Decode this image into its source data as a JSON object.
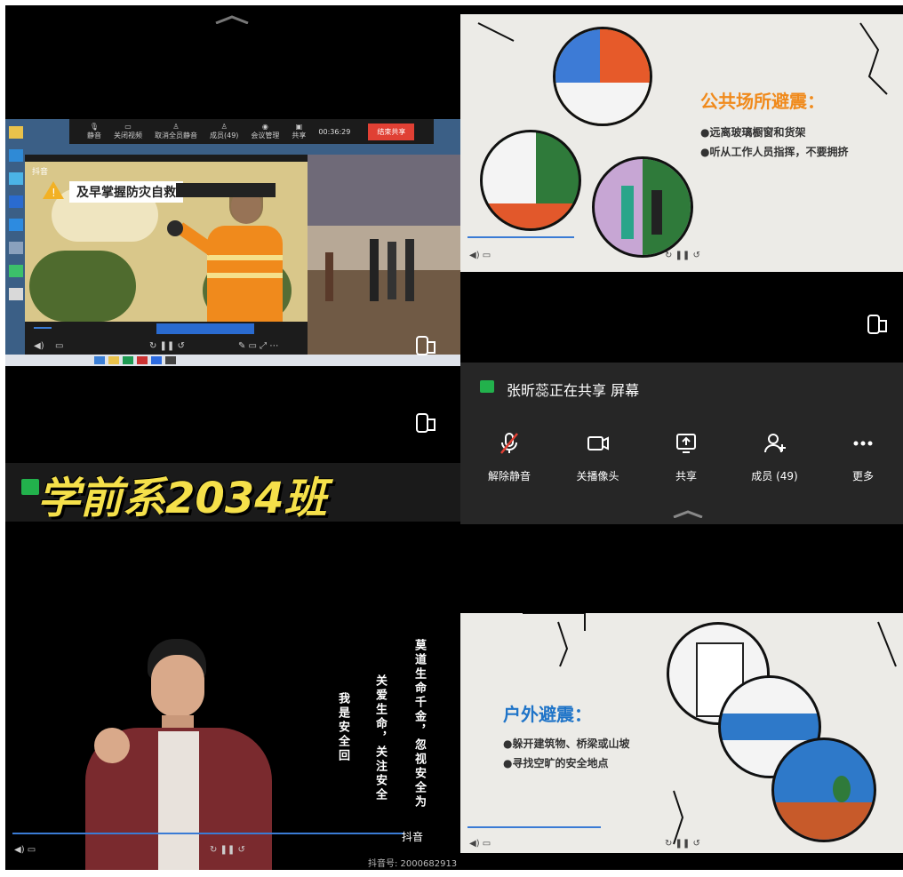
{
  "q1": {
    "meeting_toolbar": [
      {
        "label": "静音"
      },
      {
        "label": "关闭视频"
      },
      {
        "label": "取消全员静音"
      },
      {
        "label": "成员(49)"
      },
      {
        "label": "会议管理"
      },
      {
        "label": "共享"
      }
    ],
    "timer": "00:36:29",
    "end_share_label": "结束共享",
    "video_title": "及早掌握防灾自救",
    "tiktok_label": "抖音",
    "caption": "",
    "switch_view_icon": "phone-switch-icon"
  },
  "q2": {
    "slide_title": "公共场所避震：",
    "bullets": [
      "●远离玻璃橱窗和货架",
      "●听从工作人员指挥，不要拥挤"
    ],
    "status_text": "张昕蕊正在共享 屏幕",
    "controls": [
      {
        "label": "解除静音",
        "icon": "mic-muted-icon"
      },
      {
        "label": "关播像头",
        "icon": "camera-icon"
      },
      {
        "label": "共享",
        "icon": "share-screen-icon"
      },
      {
        "label": "成员 (49)",
        "icon": "members-icon"
      },
      {
        "label": "更多",
        "icon": "more-icon"
      }
    ]
  },
  "q3": {
    "class_name": "学前系2034班",
    "vertical_lines": [
      "莫道生命千金，忽视安全为",
      "关爱生命，关注安全",
      "我是安全回"
    ],
    "tiktok_label": "抖音",
    "douyin_id": "抖音号: 2000682913"
  },
  "q4": {
    "slide_title": "户外避震：",
    "bullets": [
      "●躲开建筑物、桥梁或山坡",
      "●寻找空旷的安全地点"
    ]
  },
  "colors": {
    "accent_orange": "#f08a1c",
    "blue_title": "#1f74c8",
    "red_btn": "#e04034",
    "green_share": "#22b14c"
  }
}
